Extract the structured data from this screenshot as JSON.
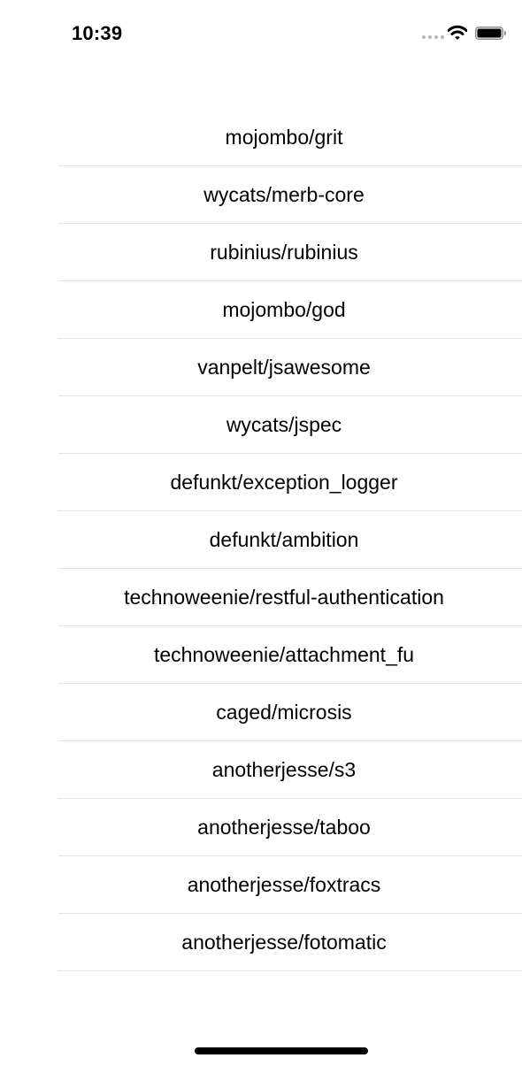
{
  "status_bar": {
    "time": "10:39",
    "signal_icon": "signal-dots-icon",
    "wifi_icon": "wifi-icon",
    "battery_icon": "battery-icon"
  },
  "repositories": [
    {
      "name": "mojombo/grit"
    },
    {
      "name": "wycats/merb-core"
    },
    {
      "name": "rubinius/rubinius"
    },
    {
      "name": "mojombo/god"
    },
    {
      "name": "vanpelt/jsawesome"
    },
    {
      "name": "wycats/jspec"
    },
    {
      "name": "defunkt/exception_logger"
    },
    {
      "name": "defunkt/ambition"
    },
    {
      "name": "technoweenie/restful-authentication"
    },
    {
      "name": "technoweenie/attachment_fu"
    },
    {
      "name": "caged/microsis"
    },
    {
      "name": "anotherjesse/s3"
    },
    {
      "name": "anotherjesse/taboo"
    },
    {
      "name": "anotherjesse/foxtracs"
    },
    {
      "name": "anotherjesse/fotomatic"
    }
  ],
  "colors": {
    "background": "#ffffff",
    "text": "#000000",
    "separator": "#e2e2e2",
    "inactive_signal": "#b8b8b8"
  }
}
